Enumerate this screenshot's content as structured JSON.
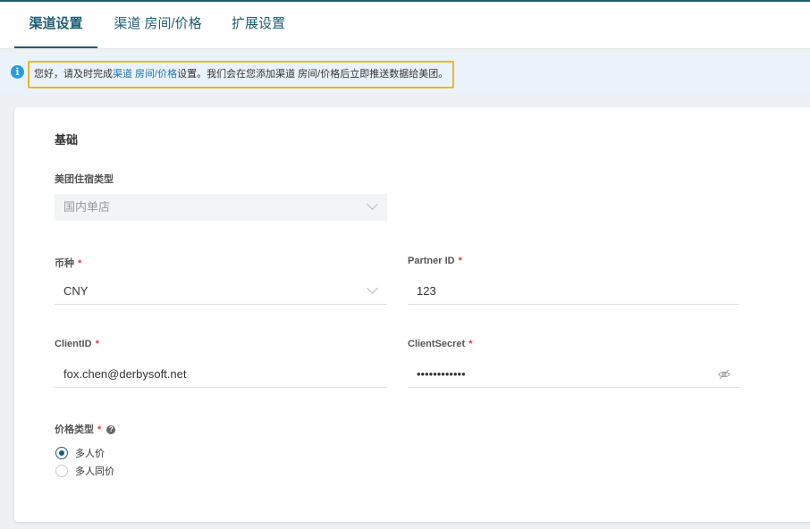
{
  "tabs": [
    {
      "label": "渠道设置",
      "active": true
    },
    {
      "label": "渠道 房间/价格",
      "active": false
    },
    {
      "label": "扩展设置",
      "active": false
    }
  ],
  "notice": {
    "prefix": "您好，请及时完成",
    "link": "渠道 房间/价格",
    "suffix": "设置。我们会在您添加渠道 房间/价格后立即推送数据给美团。"
  },
  "form": {
    "section_title": "基础",
    "accommodation_type": {
      "label": "美团住宿类型",
      "value": "国内单店"
    },
    "currency": {
      "label": "币种",
      "required": "*",
      "value": "CNY"
    },
    "partner_id": {
      "label": "Partner ID",
      "required": "*",
      "value": "123"
    },
    "client_id": {
      "label": "ClientID",
      "required": "*",
      "value": "fox.chen@derbysoft.net"
    },
    "client_secret": {
      "label": "ClientSecret",
      "required": "*",
      "value": "••••••••••••"
    },
    "price_type": {
      "label": "价格类型",
      "required": "*",
      "help": "?",
      "options": [
        {
          "label": "多人价",
          "checked": true
        },
        {
          "label": "多人同价",
          "checked": false
        }
      ]
    }
  },
  "colors": {
    "accent": "#1f5d72",
    "link": "#1f75a3",
    "required": "#e53935",
    "notice_border": "#f0b429",
    "info": "#2a9be0"
  }
}
